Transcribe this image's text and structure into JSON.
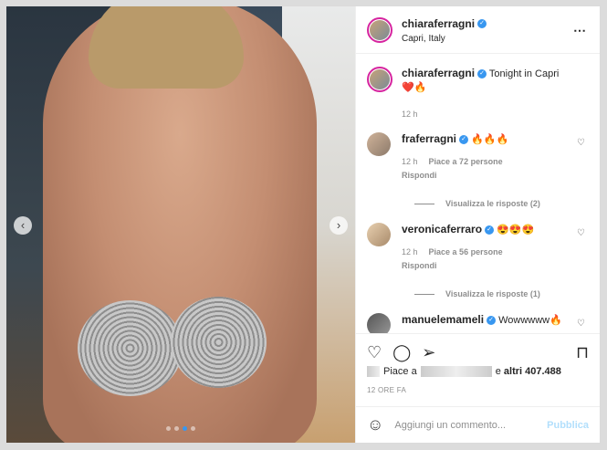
{
  "post": {
    "username": "chiaraferragni",
    "location": "Capri, Italy",
    "caption": "Tonight in Capri",
    "caption_emoji": "❤️🔥",
    "caption_time": "12 h",
    "more_icon": "⋯",
    "carousel": {
      "prev": "‹",
      "next": "›",
      "slides": 4,
      "active": 3
    }
  },
  "comments": [
    {
      "user": "fraferragni",
      "text": "🔥🔥🔥",
      "time": "12 h",
      "likes": "Piace a 72 persone",
      "reply": "Rispondi",
      "view_replies": "Visualizza le risposte (2)"
    },
    {
      "user": "veronicaferraro",
      "text": "😍😍😍",
      "time": "12 h",
      "likes": "Piace a 56 persone",
      "reply": "Rispondi",
      "view_replies": "Visualizza le risposte (1)"
    },
    {
      "user": "manuelemameli",
      "text": "Wowwwww🔥"
    }
  ],
  "likes_line": {
    "prefix": "Piace a",
    "suffix": "e",
    "others": "altri 407.488"
  },
  "timestamp": "12 ORE FA",
  "add_comment": {
    "placeholder": "Aggiungi un commento...",
    "publish": "Pubblica"
  },
  "colors": {
    "accent": "#3897f0",
    "publish_disabled": "#b2dffc"
  }
}
